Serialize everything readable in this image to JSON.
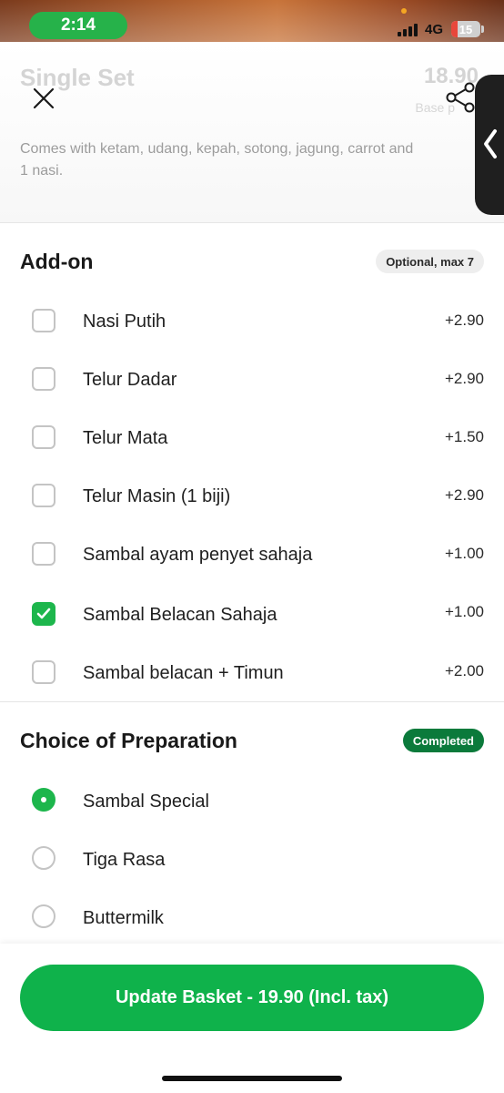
{
  "status_bar": {
    "time": "2:14",
    "network": "4G",
    "battery": "15"
  },
  "item": {
    "name": "Single Set",
    "price": "18.90",
    "price_caption": "Base p",
    "description_line1": "Comes with ketam, udang, kepah, sotong, jagung, carrot and",
    "description_line2": "1 nasi."
  },
  "addon": {
    "title": "Add-on",
    "badge": "Optional, max 7",
    "options": [
      {
        "label": "Nasi Putih",
        "price": "+2.90",
        "checked": false
      },
      {
        "label": "Telur Dadar",
        "price": "+2.90",
        "checked": false
      },
      {
        "label": "Telur Mata",
        "price": "+1.50",
        "checked": false
      },
      {
        "label": "Telur Masin (1 biji)",
        "price": "+2.90",
        "checked": false
      },
      {
        "label": "Sambal ayam penyet sahaja",
        "price": "+1.00",
        "checked": false
      },
      {
        "label": "Sambal Belacan Sahaja",
        "price": "+1.00",
        "checked": true
      },
      {
        "label": "Sambal belacan + Timun",
        "price": "+2.00",
        "checked": false
      }
    ]
  },
  "preparation": {
    "title": "Choice of Preparation",
    "badge": "Completed",
    "options": [
      {
        "label": "Sambal Special",
        "selected": true
      },
      {
        "label": "Tiga Rasa",
        "selected": false
      },
      {
        "label": "Buttermilk",
        "selected": false
      }
    ]
  },
  "cta": {
    "label": "Update Basket - 19.90 (Incl. tax)"
  },
  "colors": {
    "brand_green": "#0fb24b",
    "completed_badge": "#0b7a3b",
    "checked_green": "#1db64c"
  },
  "icons": {
    "close": "close-icon",
    "share": "share-icon",
    "handle": "chevron-left-icon",
    "check": "check-icon"
  }
}
